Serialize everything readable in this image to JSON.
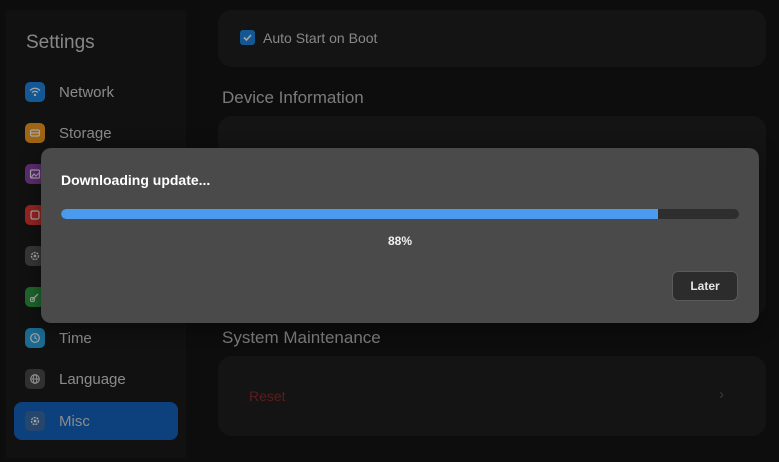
{
  "sidebar": {
    "title": "Settings",
    "items": [
      {
        "label": "Network",
        "icon": "wifi-icon",
        "color": "#1e88e5"
      },
      {
        "label": "Storage",
        "icon": "storage-icon",
        "color": "#f29c1f"
      },
      {
        "label": "",
        "icon": "image-icon",
        "color": "#8e44ad"
      },
      {
        "label": "",
        "icon": "display-icon",
        "color": "#e53935"
      },
      {
        "label": "",
        "icon": "gear-icon",
        "color": "#555555"
      },
      {
        "label": "",
        "icon": "link-icon",
        "color": "#2e9e44"
      },
      {
        "label": "Time",
        "icon": "clock-icon",
        "color": "#29a3e0"
      },
      {
        "label": "Language",
        "icon": "globe-icon",
        "color": "#4a4a4a"
      },
      {
        "label": "Misc",
        "icon": "gear-icon",
        "color": "#3a6ea8"
      }
    ],
    "active_index": 8
  },
  "main": {
    "auto_start_label": "Auto Start on Boot",
    "auto_start_checked": true,
    "device_info_title": "Device Information",
    "system_maintenance_title": "System Maintenance",
    "reset_label": "Reset",
    "reset_color": "#8b2d2d"
  },
  "dialog": {
    "title": "Downloading update...",
    "progress_value": 0.88,
    "progress_text": "88%",
    "later_label": "Later",
    "accent": "#4a9bf0"
  }
}
